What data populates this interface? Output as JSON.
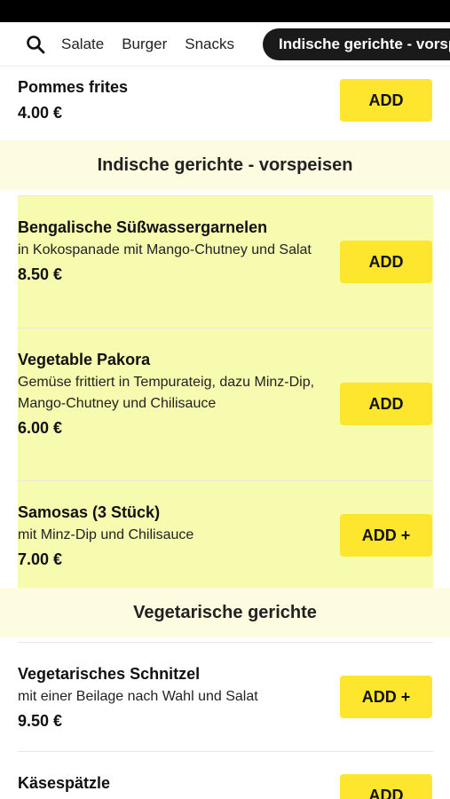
{
  "nav": {
    "tabs": [
      {
        "label": "Salate"
      },
      {
        "label": "Burger"
      },
      {
        "label": "Snacks"
      },
      {
        "label": "Indische gerichte - vorspeisen"
      }
    ]
  },
  "items": {
    "pommes": {
      "name": "Pommes frites",
      "price": "4.00 €",
      "button": "ADD"
    },
    "garnelen": {
      "name": "Bengalische Süßwassergarnelen",
      "desc": "in Kokospanade mit Mango-Chutney und Salat",
      "price": "8.50 €",
      "button": "ADD"
    },
    "pakora": {
      "name": "Vegetable Pakora",
      "desc": "Gemüse frittiert in Tempurateig, dazu Minz-Dip, Mango-Chutney und Chilisauce",
      "price": "6.00 €",
      "button": "ADD"
    },
    "samosas": {
      "name": "Samosas (3 Stück)",
      "desc": "mit Minz-Dip und Chilisauce",
      "price": "7.00 €",
      "button": "ADD +"
    },
    "schnitzel": {
      "name": "Vegetarisches Schnitzel",
      "desc": "mit einer Beilage nach Wahl und Salat",
      "price": "9.50 €",
      "button": "ADD +"
    },
    "kaesespaetzle": {
      "name": "Käsespätzle",
      "button": "ADD"
    }
  },
  "sections": {
    "indisch": "Indische gerichte - vorspeisen",
    "vegetarisch": "Vegetarische gerichte"
  },
  "colors": {
    "accent": "#fde62d",
    "highlight": "#f6fbb0",
    "section_bg": "#fdfbe0",
    "active_tab_bg": "#1a1a1a"
  }
}
